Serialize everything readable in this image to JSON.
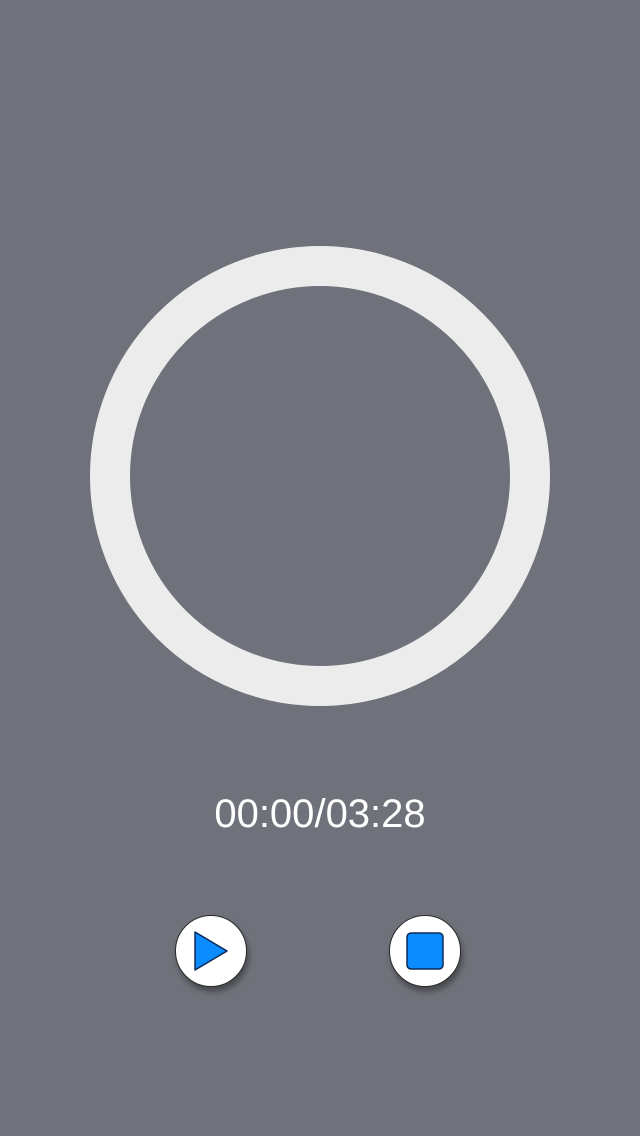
{
  "player": {
    "elapsed": "00:00",
    "separator": "/",
    "duration": "03:28",
    "progress": 0
  },
  "controls": {
    "play_icon": "play-icon",
    "stop_icon": "stop-icon"
  },
  "colors": {
    "background": "#6f727a",
    "ring": "#ececec",
    "accent": "#0a8cff",
    "text": "#ffffff"
  }
}
